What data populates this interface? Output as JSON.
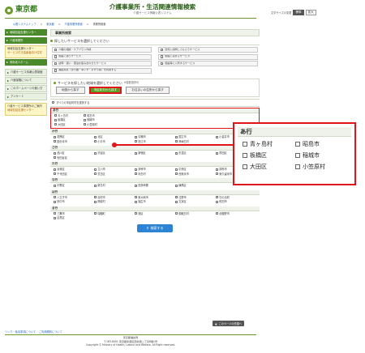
{
  "header": {
    "logo_text": "東京都",
    "title": "介護事業所・生活関連情報検索",
    "subtitle": "介護サービス情報公表システム",
    "font_size_label": "文字サイズの変更",
    "font_buttons": [
      "標準",
      "拡大"
    ]
  },
  "breadcrumb": [
    "公表システムトップ",
    "東京都",
    "介護事業所検索",
    "事業所検索"
  ],
  "nav": {
    "items": [
      {
        "label": "地域包括支援センター",
        "style": "green"
      },
      {
        "label": "介護事業所",
        "style": "green"
      },
      {
        "label": "地域包括支援センター",
        "style": "yellow",
        "sub": "サービス付き高齢者向け住宅"
      },
      {
        "label": "有料老人ホーム",
        "style": "green"
      },
      {
        "label": "介護サービス情報公表制度",
        "style": "light"
      },
      {
        "label": "介護保険について",
        "style": "light"
      },
      {
        "label": "このホームページの使い方",
        "style": "light"
      },
      {
        "label": "アンケート",
        "style": "light"
      },
      {
        "label": "介護サービス事業所のご案内",
        "style": "yellow",
        "sub": "地域包括支援センター"
      }
    ]
  },
  "main": {
    "section_title": "事業所検索",
    "service_question": "探したいサービスを選択してください",
    "services": [
      "介護の相談・ケアプラン作成",
      "自宅に訪問してもらうサービス",
      "施設に通うサービス",
      "施設に泊まるサービス",
      "訪問・通い・宿泊を組み合わせたサービス",
      "施設等に入所するサービス",
      "福祉用具（歩行器・車いす・手すり等）を利用する",
      ""
    ],
    "area_question": "サービスを探したい地域を選択してください",
    "area_note": "※複数選択可",
    "area_buttons": [
      {
        "label": "地図から探す",
        "active": false
      },
      {
        "label": "市区町村から探す",
        "active": true
      },
      {
        "label": "お住まいの住所から探す",
        "active": false
      }
    ],
    "select_all": "すべての市区町村を選択する",
    "regions": [
      {
        "name": "あ行",
        "items": [
          "青ヶ島村",
          "昭島市",
          "板橋区",
          "稲城市",
          "大田区",
          "小笠原村",
          "",
          "",
          "",
          ""
        ]
      },
      {
        "name": "か行",
        "items": [
          "葛飾区",
          "北区",
          "清瀬市",
          "国立市",
          "小金井市",
          "国分寺市",
          "小平市",
          "狛江市",
          "神津島村",
          ""
        ]
      },
      {
        "name": "さ行",
        "items": [
          "品川区",
          "渋谷区",
          "新宿区",
          "杉並区",
          "墨田区",
          "世田谷区",
          "",
          "",
          "",
          ""
        ]
      },
      {
        "name": "た行",
        "items": [
          "台東区",
          "立川市",
          "多摩市",
          "中央区",
          "調布市",
          "千代田区",
          "豊島区",
          "利島村",
          "西東京市",
          "東久留米市"
        ]
      },
      {
        "name": "な行",
        "items": [
          "中野区",
          "新島村",
          "西多摩郡",
          "練馬区",
          "",
          "",
          "",
          "",
          "",
          ""
        ]
      },
      {
        "name": "は行",
        "items": [
          "八王子市",
          "羽村市",
          "東大和市",
          "日野市",
          "日の出町",
          "府中市",
          "檜原村",
          "福生市",
          "文京区",
          "町田市"
        ]
      },
      {
        "name": "ま行",
        "items": [
          "三鷹市",
          "瑞穂町",
          "港区",
          "御蔵島村",
          "武蔵野市",
          "目黒区",
          "",
          "",
          "",
          ""
        ]
      }
    ],
    "search_button": "検索する",
    "back_button": "このページの先頭へ"
  },
  "footer": {
    "links": [
      "リンク・免責事項について",
      "ご利用規約について"
    ],
    "org": "東京都福祉局",
    "address": "〒163-8001 東京都新宿区西新宿二丁目8番1号",
    "copyright": "Copyright © Ministry of Health, Labour and Welfare, All Right reserved."
  },
  "zoom": {
    "header": "あ行",
    "items": [
      "青ヶ島村",
      "昭島市",
      "板橋区",
      "稲城市",
      "大田区",
      "小笠原村"
    ]
  },
  "colors": {
    "accent": "#5a9d24",
    "highlight": "#e0141b",
    "search": "#2d84d4"
  }
}
